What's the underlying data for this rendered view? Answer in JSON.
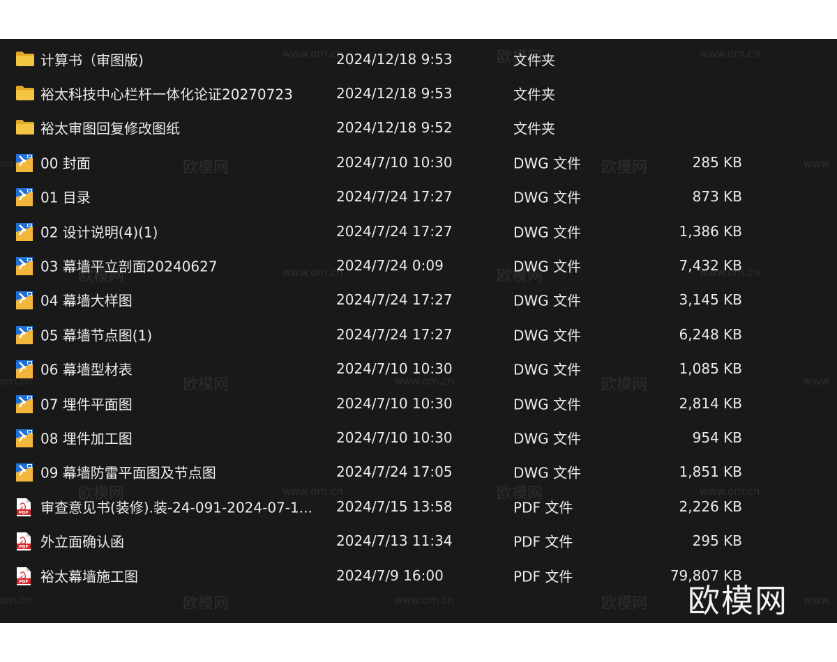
{
  "files": [
    {
      "name": "计算书（审图版)",
      "date": "2024/12/18 9:53",
      "type": "文件夹",
      "size": "",
      "icon": "folder-icon"
    },
    {
      "name": "裕太科技中心栏杆一体化论证20270723",
      "date": "2024/12/18 9:53",
      "type": "文件夹",
      "size": "",
      "icon": "folder-icon"
    },
    {
      "name": "裕太审图回复修改图纸",
      "date": "2024/12/18 9:52",
      "type": "文件夹",
      "size": "",
      "icon": "folder-icon"
    },
    {
      "name": "00 封面",
      "date": "2024/7/10 10:30",
      "type": "DWG 文件",
      "size": "285 KB",
      "icon": "dwg-file-icon"
    },
    {
      "name": "01 目录",
      "date": "2024/7/24 17:27",
      "type": "DWG 文件",
      "size": "873 KB",
      "icon": "dwg-file-icon"
    },
    {
      "name": "02 设计说明(4)(1)",
      "date": "2024/7/24 17:27",
      "type": "DWG 文件",
      "size": "1,386 KB",
      "icon": "dwg-file-icon"
    },
    {
      "name": "03 幕墙平立剖面20240627",
      "date": "2024/7/24 0:09",
      "type": "DWG 文件",
      "size": "7,432 KB",
      "icon": "dwg-file-icon"
    },
    {
      "name": "04 幕墙大样图",
      "date": "2024/7/24 17:27",
      "type": "DWG 文件",
      "size": "3,145 KB",
      "icon": "dwg-file-icon"
    },
    {
      "name": "05 幕墙节点图(1)",
      "date": "2024/7/24 17:27",
      "type": "DWG 文件",
      "size": "6,248 KB",
      "icon": "dwg-file-icon"
    },
    {
      "name": "06 幕墙型材表",
      "date": "2024/7/10 10:30",
      "type": "DWG 文件",
      "size": "1,085 KB",
      "icon": "dwg-file-icon"
    },
    {
      "name": "07 埋件平面图",
      "date": "2024/7/10 10:30",
      "type": "DWG 文件",
      "size": "2,814 KB",
      "icon": "dwg-file-icon"
    },
    {
      "name": "08 埋件加工图",
      "date": "2024/7/10 10:30",
      "type": "DWG 文件",
      "size": "954 KB",
      "icon": "dwg-file-icon"
    },
    {
      "name": "09 幕墙防雷平面图及节点图",
      "date": "2024/7/24 17:05",
      "type": "DWG 文件",
      "size": "1,851 KB",
      "icon": "dwg-file-icon"
    },
    {
      "name": "审查意见书(装修).装-24-091-2024-07-1...",
      "date": "2024/7/15 13:58",
      "type": "PDF 文件",
      "size": "2,226 KB",
      "icon": "pdf-file-icon"
    },
    {
      "name": "外立面确认函",
      "date": "2024/7/13 11:34",
      "type": "PDF 文件",
      "size": "295 KB",
      "icon": "pdf-file-icon"
    },
    {
      "name": "裕太幕墙施工图",
      "date": "2024/7/9 16:00",
      "type": "PDF 文件",
      "size": "79,807 KB",
      "icon": "pdf-file-icon"
    }
  ],
  "watermark": {
    "url": "www.om.cn",
    "cn": "欧模网",
    "url_partial": "om.cn",
    "url_partial_left": "www."
  },
  "brand": "欧模网",
  "colors": {
    "background": "#191919",
    "text": "#ececec",
    "folder": "#f4c542",
    "dwg_blue": "#1f6fd6",
    "pdf_red": "#d9272e"
  }
}
